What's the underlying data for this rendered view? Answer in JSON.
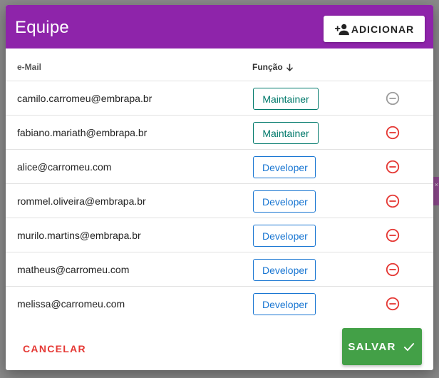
{
  "dialog": {
    "title": "Equipe",
    "add_label": "ADICIONAR"
  },
  "table": {
    "columns": {
      "email": "e-Mail",
      "role": "Função"
    },
    "rows": [
      {
        "email": "camilo.carromeu@embrapa.br",
        "role": "Maintainer",
        "removable": false
      },
      {
        "email": "fabiano.mariath@embrapa.br",
        "role": "Maintainer",
        "removable": true
      },
      {
        "email": "alice@carromeu.com",
        "role": "Developer",
        "removable": true
      },
      {
        "email": "rommel.oliveira@embrapa.br",
        "role": "Developer",
        "removable": true
      },
      {
        "email": "murilo.martins@embrapa.br",
        "role": "Developer",
        "removable": true
      },
      {
        "email": "matheus@carromeu.com",
        "role": "Developer",
        "removable": true
      },
      {
        "email": "melissa@carromeu.com",
        "role": "Developer",
        "removable": true
      }
    ]
  },
  "footer": {
    "cancel_label": "CANCELAR",
    "save_label": "SALVAR"
  },
  "colors": {
    "header": "#8e24aa",
    "maintainer": "#00796b",
    "developer": "#1976d2",
    "remove": "#e53935",
    "remove_disabled": "#9e9e9e",
    "save": "#43a047"
  },
  "icons": {
    "add": "person-add-icon",
    "sort": "arrow-down-icon",
    "remove": "remove-circle-icon",
    "save": "check-icon"
  }
}
